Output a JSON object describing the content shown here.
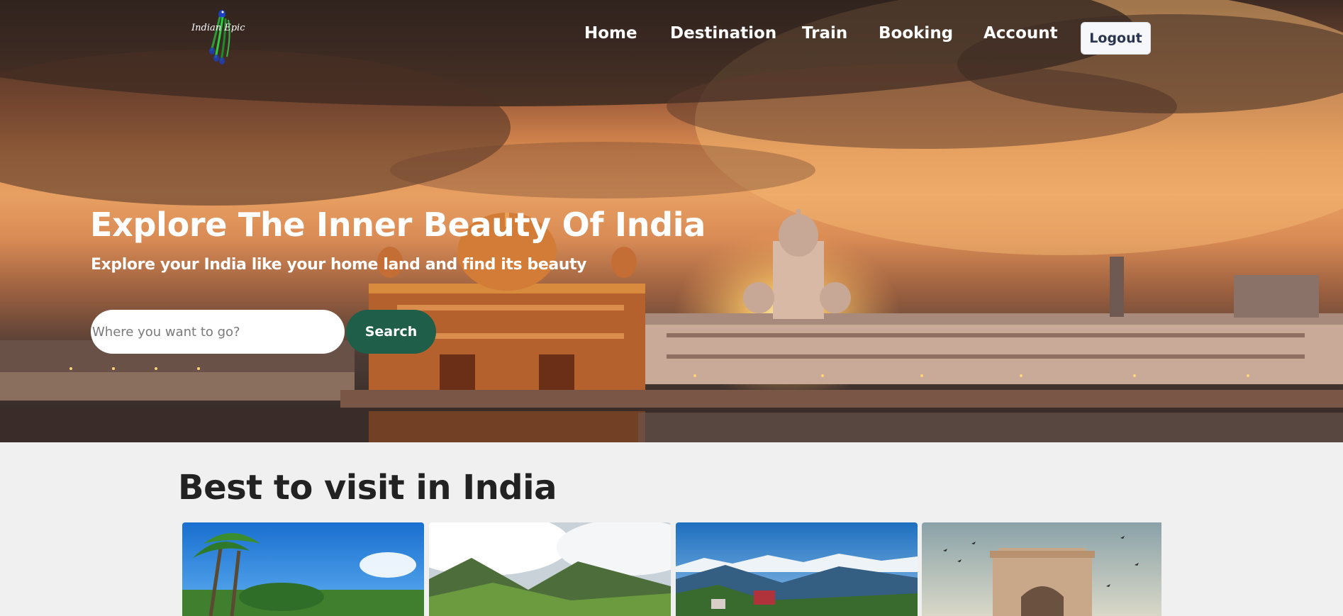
{
  "brand": {
    "logo_text": "Indian Epic"
  },
  "nav": {
    "links": [
      "Home",
      "Destination",
      "Train",
      "Booking",
      "Account"
    ],
    "logout_label": "Logout"
  },
  "hero": {
    "title": "Explore The Inner Beauty Of India",
    "subtitle": "Explore your India like your home land and find its beauty",
    "search": {
      "placeholder": "Where you want to go?",
      "button_label": "Search"
    }
  },
  "section": {
    "title": "Best to visit in India",
    "cards": [
      {
        "image": "beach-palm-trees"
      },
      {
        "image": "mountain-valley-clouds"
      },
      {
        "image": "hill-town-snow-peaks"
      },
      {
        "image": "india-gate"
      }
    ]
  },
  "colors": {
    "search_button": "#1f5e48",
    "nav_text": "#ffffff",
    "logout_text": "#2b3550",
    "section_background": "#f0f0f0"
  }
}
